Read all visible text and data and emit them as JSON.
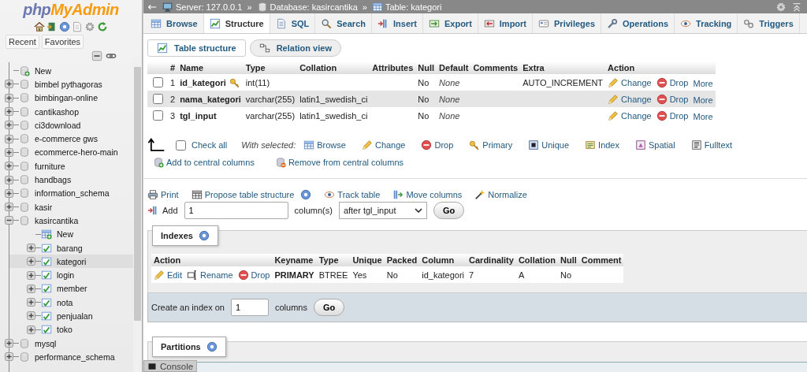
{
  "logo": {
    "part1": "php",
    "part2": "MyAdmin"
  },
  "sidebar": {
    "tabs": [
      {
        "label": "Recent"
      },
      {
        "label": "Favorites"
      }
    ],
    "tree": [
      {
        "kind": "new",
        "label": "New",
        "selected": false
      },
      {
        "kind": "database",
        "label": "bimbel pythagoras",
        "expanded": false,
        "selected": false
      },
      {
        "kind": "database",
        "label": "bimbingan-online",
        "expanded": false,
        "selected": false
      },
      {
        "kind": "database",
        "label": "cantikashop",
        "expanded": false,
        "selected": false
      },
      {
        "kind": "database",
        "label": "ci3download",
        "expanded": false,
        "selected": false
      },
      {
        "kind": "database",
        "label": "e-commerce gws",
        "expanded": false,
        "selected": false
      },
      {
        "kind": "database",
        "label": "ecommerce-hero-main",
        "expanded": false,
        "selected": false
      },
      {
        "kind": "database",
        "label": "furniture",
        "expanded": false,
        "selected": false
      },
      {
        "kind": "database",
        "label": "handbags",
        "expanded": false,
        "selected": false
      },
      {
        "kind": "database",
        "label": "information_schema",
        "expanded": false,
        "selected": false
      },
      {
        "kind": "database",
        "label": "kasir",
        "expanded": false,
        "selected": false
      },
      {
        "kind": "database",
        "label": "kasircantika",
        "expanded": true,
        "selected": false,
        "children": [
          {
            "kind": "new_table",
            "label": "New",
            "selected": false
          },
          {
            "kind": "table",
            "label": "barang",
            "expanded": false,
            "selected": false
          },
          {
            "kind": "table",
            "label": "kategori",
            "expanded": false,
            "selected": true
          },
          {
            "kind": "table",
            "label": "login",
            "expanded": false,
            "selected": false
          },
          {
            "kind": "table",
            "label": "member",
            "expanded": false,
            "selected": false
          },
          {
            "kind": "table",
            "label": "nota",
            "expanded": false,
            "selected": false
          },
          {
            "kind": "table",
            "label": "penjualan",
            "expanded": false,
            "selected": false
          },
          {
            "kind": "table",
            "label": "toko",
            "expanded": false,
            "selected": false
          }
        ]
      },
      {
        "kind": "database",
        "label": "mysql",
        "expanded": false,
        "selected": false
      },
      {
        "kind": "database",
        "label": "performance_schema",
        "expanded": false,
        "selected": false
      }
    ]
  },
  "breadcrumb": [
    {
      "kind": "server",
      "label": "Server: 127.0.0.1"
    },
    {
      "kind": "separator",
      "label": "»"
    },
    {
      "kind": "database",
      "label": "Database: kasircantika"
    },
    {
      "kind": "separator",
      "label": "»"
    },
    {
      "kind": "table",
      "label": "Table: kategori"
    }
  ],
  "tabs": [
    {
      "kind": "browse",
      "label": "Browse",
      "selected": false
    },
    {
      "kind": "structure",
      "label": "Structure",
      "selected": true
    },
    {
      "kind": "sql",
      "label": "SQL",
      "selected": false
    },
    {
      "kind": "search",
      "label": "Search",
      "selected": false
    },
    {
      "kind": "insert",
      "label": "Insert",
      "selected": false
    },
    {
      "kind": "export",
      "label": "Export",
      "selected": false
    },
    {
      "kind": "import",
      "label": "Import",
      "selected": false
    },
    {
      "kind": "privileges",
      "label": "Privileges",
      "selected": false
    },
    {
      "kind": "operations",
      "label": "Operations",
      "selected": false
    },
    {
      "kind": "tracking",
      "label": "Tracking",
      "selected": false
    },
    {
      "kind": "triggers",
      "label": "Triggers",
      "selected": false
    }
  ],
  "subtabs": [
    {
      "kind": "structure",
      "label": "Table structure",
      "selected": true
    },
    {
      "kind": "relation",
      "label": "Relation view",
      "selected": false
    }
  ],
  "structure_table": {
    "columns": [
      "#",
      "Name",
      "Type",
      "Collation",
      "Attributes",
      "Null",
      "Default",
      "Comments",
      "Extra",
      "Action"
    ],
    "rows": [
      {
        "checked": false,
        "highlighted": false,
        "number": "1",
        "name": "id_kategori",
        "primary_key": true,
        "type": "int(11)",
        "null": "No",
        "default": "None",
        "extra": "AUTO_INCREMENT",
        "actions": [
          {
            "kind": "change",
            "label": "Change"
          },
          {
            "kind": "drop",
            "label": "Drop"
          },
          {
            "kind": "more",
            "label": "More"
          }
        ]
      },
      {
        "checked": false,
        "highlighted": true,
        "number": "2",
        "name": "nama_kategori",
        "primary_key": false,
        "type": "varchar(255)",
        "collation": "latin1_swedish_ci",
        "null": "No",
        "default": "None",
        "actions": [
          {
            "kind": "change",
            "label": "Change"
          },
          {
            "kind": "drop",
            "label": "Drop"
          },
          {
            "kind": "more",
            "label": "More"
          }
        ]
      },
      {
        "checked": false,
        "highlighted": false,
        "number": "3",
        "name": "tgl_input",
        "primary_key": false,
        "type": "varchar(255)",
        "collation": "latin1_swedish_ci",
        "null": "No",
        "default": "None",
        "actions": [
          {
            "kind": "change",
            "label": "Change"
          },
          {
            "kind": "drop",
            "label": "Drop"
          },
          {
            "kind": "more",
            "label": "More"
          }
        ]
      }
    ]
  },
  "bulk": {
    "check_all": {
      "label": "Check all",
      "checked": false
    },
    "with_selected": "With selected:",
    "actions": [
      {
        "kind": "browse",
        "label": "Browse"
      },
      {
        "kind": "change",
        "label": "Change"
      },
      {
        "kind": "drop",
        "label": "Drop"
      },
      {
        "kind": "primary",
        "label": "Primary"
      },
      {
        "kind": "unique",
        "label": "Unique"
      },
      {
        "kind": "index",
        "label": "Index"
      },
      {
        "kind": "spatial",
        "label": "Spatial"
      },
      {
        "kind": "fulltext",
        "label": "Fulltext"
      }
    ],
    "central": [
      {
        "kind": "central_add",
        "label": "Add to central columns"
      },
      {
        "kind": "central_remove",
        "label": "Remove from central columns"
      }
    ]
  },
  "tools": [
    {
      "kind": "print",
      "label": "Print",
      "help": false
    },
    {
      "kind": "propose",
      "label": "Propose table structure",
      "help": true
    },
    {
      "kind": "tracking",
      "label": "Track table",
      "help": false
    },
    {
      "kind": "move",
      "label": "Move columns",
      "help": false
    },
    {
      "kind": "normalize",
      "label": "Normalize",
      "help": false
    }
  ],
  "add_columns": {
    "label": "Add",
    "value": "1",
    "unit": "column(s)",
    "position": "after tgl_input",
    "button": "Go"
  },
  "indexes": {
    "legend": "Indexes",
    "columns": [
      "Action",
      "Keyname",
      "Type",
      "Unique",
      "Packed",
      "Column",
      "Cardinality",
      "Collation",
      "Null",
      "Comment"
    ],
    "rows": [
      {
        "actions": [
          {
            "kind": "change",
            "label": "Edit"
          },
          {
            "kind": "rename",
            "label": "Rename"
          },
          {
            "kind": "drop",
            "label": "Drop"
          }
        ],
        "keyname": "PRIMARY",
        "type": "BTREE",
        "unique": "Yes",
        "packed": "No",
        "column": "id_kategori",
        "cardinality": "7",
        "collation": "A",
        "null": "No"
      }
    ],
    "create": {
      "label": "Create an index on",
      "value": "1",
      "unit": "columns",
      "button": "Go"
    }
  },
  "partitions": {
    "legend": "Partitions"
  },
  "console": {
    "label": "Console"
  }
}
